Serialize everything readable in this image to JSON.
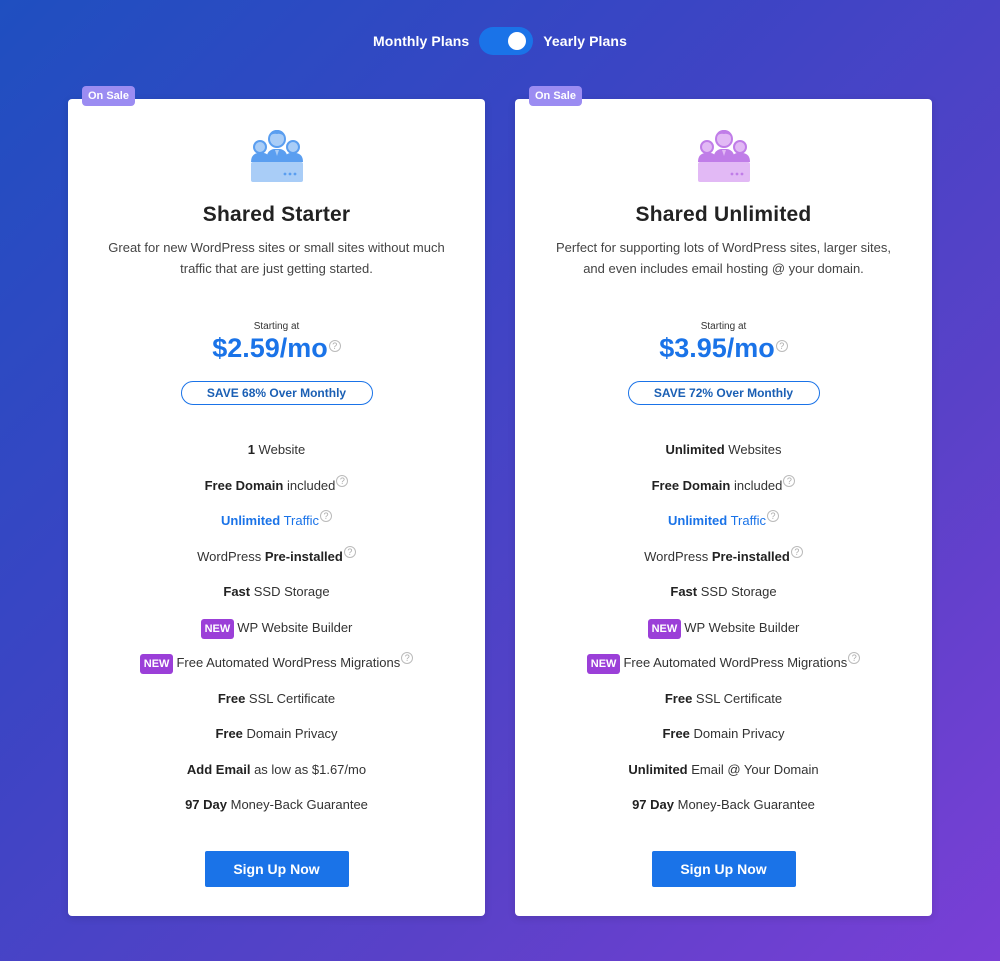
{
  "toggle": {
    "monthly_label": "Monthly Plans",
    "yearly_label": "Yearly Plans",
    "selected": "Yearly Plans"
  },
  "colors": {
    "accent": "#1a73e8",
    "badge": "#9b8cf2",
    "new_tag": "#9b3fd8",
    "starter_icon": "#5a9ef0",
    "unlimited_icon": "#c07de8"
  },
  "plans": [
    {
      "badge": "On Sale",
      "icon": "people-server-icon",
      "title": "Shared Starter",
      "description": "Great for new WordPress sites or small sites without much traffic that are just getting started.",
      "starting_label": "Starting at",
      "price": "$2.59/mo",
      "price_help": "?",
      "save": "SAVE 68% Over Monthly",
      "features": [
        {
          "bold": "1",
          "text": " Website",
          "help": ""
        },
        {
          "bold": "Free Domain",
          "text": " included",
          "help": "?"
        },
        {
          "bold": "Unlimited",
          "text": " Traffic",
          "help": "?"
        },
        {
          "pre": "WordPress ",
          "bold": "Pre-installed",
          "text": "",
          "help": "?"
        },
        {
          "bold": "Fast",
          "text": " SSD Storage",
          "help": ""
        },
        {
          "tag": "NEW",
          "text": "WP Website Builder",
          "help": ""
        },
        {
          "tag": "NEW",
          "text": "Free Automated WordPress Migrations",
          "help": "?"
        },
        {
          "bold": "Free",
          "text": " SSL Certificate",
          "help": ""
        },
        {
          "bold": "Free",
          "text": " Domain Privacy",
          "help": ""
        },
        {
          "bold": "Add Email",
          "text": " as low as $1.67/mo",
          "help": ""
        },
        {
          "bold": "97 Day",
          "text": " Money-Back Guarantee",
          "help": ""
        }
      ],
      "cta": "Sign Up Now"
    },
    {
      "badge": "On Sale",
      "icon": "people-server-icon",
      "title": "Shared Unlimited",
      "description": "Perfect for supporting lots of WordPress sites, larger sites, and even includes email hosting @ your domain.",
      "starting_label": "Starting at",
      "price": "$3.95/mo",
      "price_help": "?",
      "save": "SAVE 72% Over Monthly",
      "features": [
        {
          "bold": "Unlimited",
          "text": " Websites",
          "help": ""
        },
        {
          "bold": "Free Domain",
          "text": " included",
          "help": "?"
        },
        {
          "bold": "Unlimited",
          "text": " Traffic",
          "help": "?"
        },
        {
          "pre": "WordPress ",
          "bold": "Pre-installed",
          "text": "",
          "help": "?"
        },
        {
          "bold": "Fast",
          "text": " SSD Storage",
          "help": ""
        },
        {
          "tag": "NEW",
          "text": "WP Website Builder",
          "help": ""
        },
        {
          "tag": "NEW",
          "text": "Free Automated WordPress Migrations",
          "help": "?"
        },
        {
          "bold": "Free",
          "text": " SSL Certificate",
          "help": ""
        },
        {
          "bold": "Free",
          "text": " Domain Privacy",
          "help": ""
        },
        {
          "bold": "Unlimited",
          "text": " Email @ Your Domain",
          "help": ""
        },
        {
          "bold": "97 Day",
          "text": " Money-Back Guarantee",
          "help": ""
        }
      ],
      "cta": "Sign Up Now"
    }
  ]
}
